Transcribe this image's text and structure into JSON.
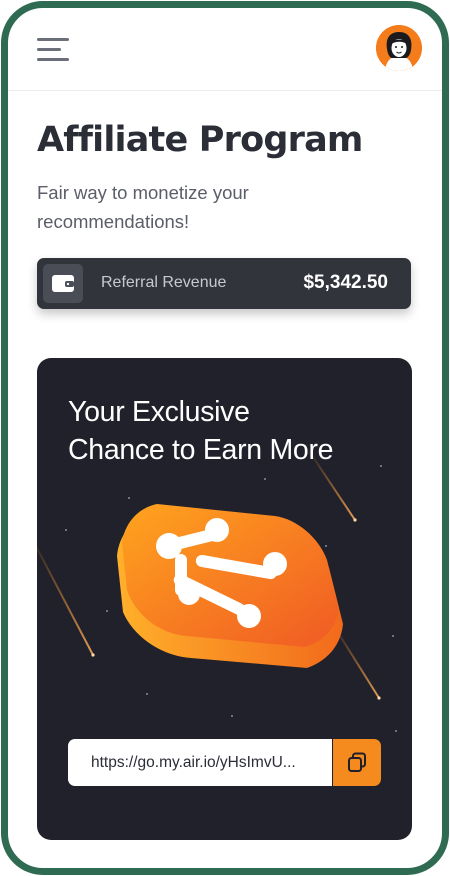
{
  "header": {
    "menu_icon": "hamburger-menu-icon",
    "avatar_icon": "user-avatar-icon"
  },
  "page": {
    "title": "Affiliate Program",
    "subtitle": "Fair way to monetize your recommendations!"
  },
  "revenue": {
    "icon": "wallet-icon",
    "label": "Referral Revenue",
    "value": "$5,342.50"
  },
  "promo": {
    "title_line1": "Your Exclusive",
    "title_line2": "Chance to Earn More",
    "logo_icon": "air-io-logo-icon",
    "link": "https://go.my.air.io/yHsImvU...",
    "copy_icon": "copy-icon"
  },
  "colors": {
    "frame": "#2e6b52",
    "card": "#20212a",
    "accent": "#f58a1f",
    "revenue_bar": "#32343c"
  }
}
